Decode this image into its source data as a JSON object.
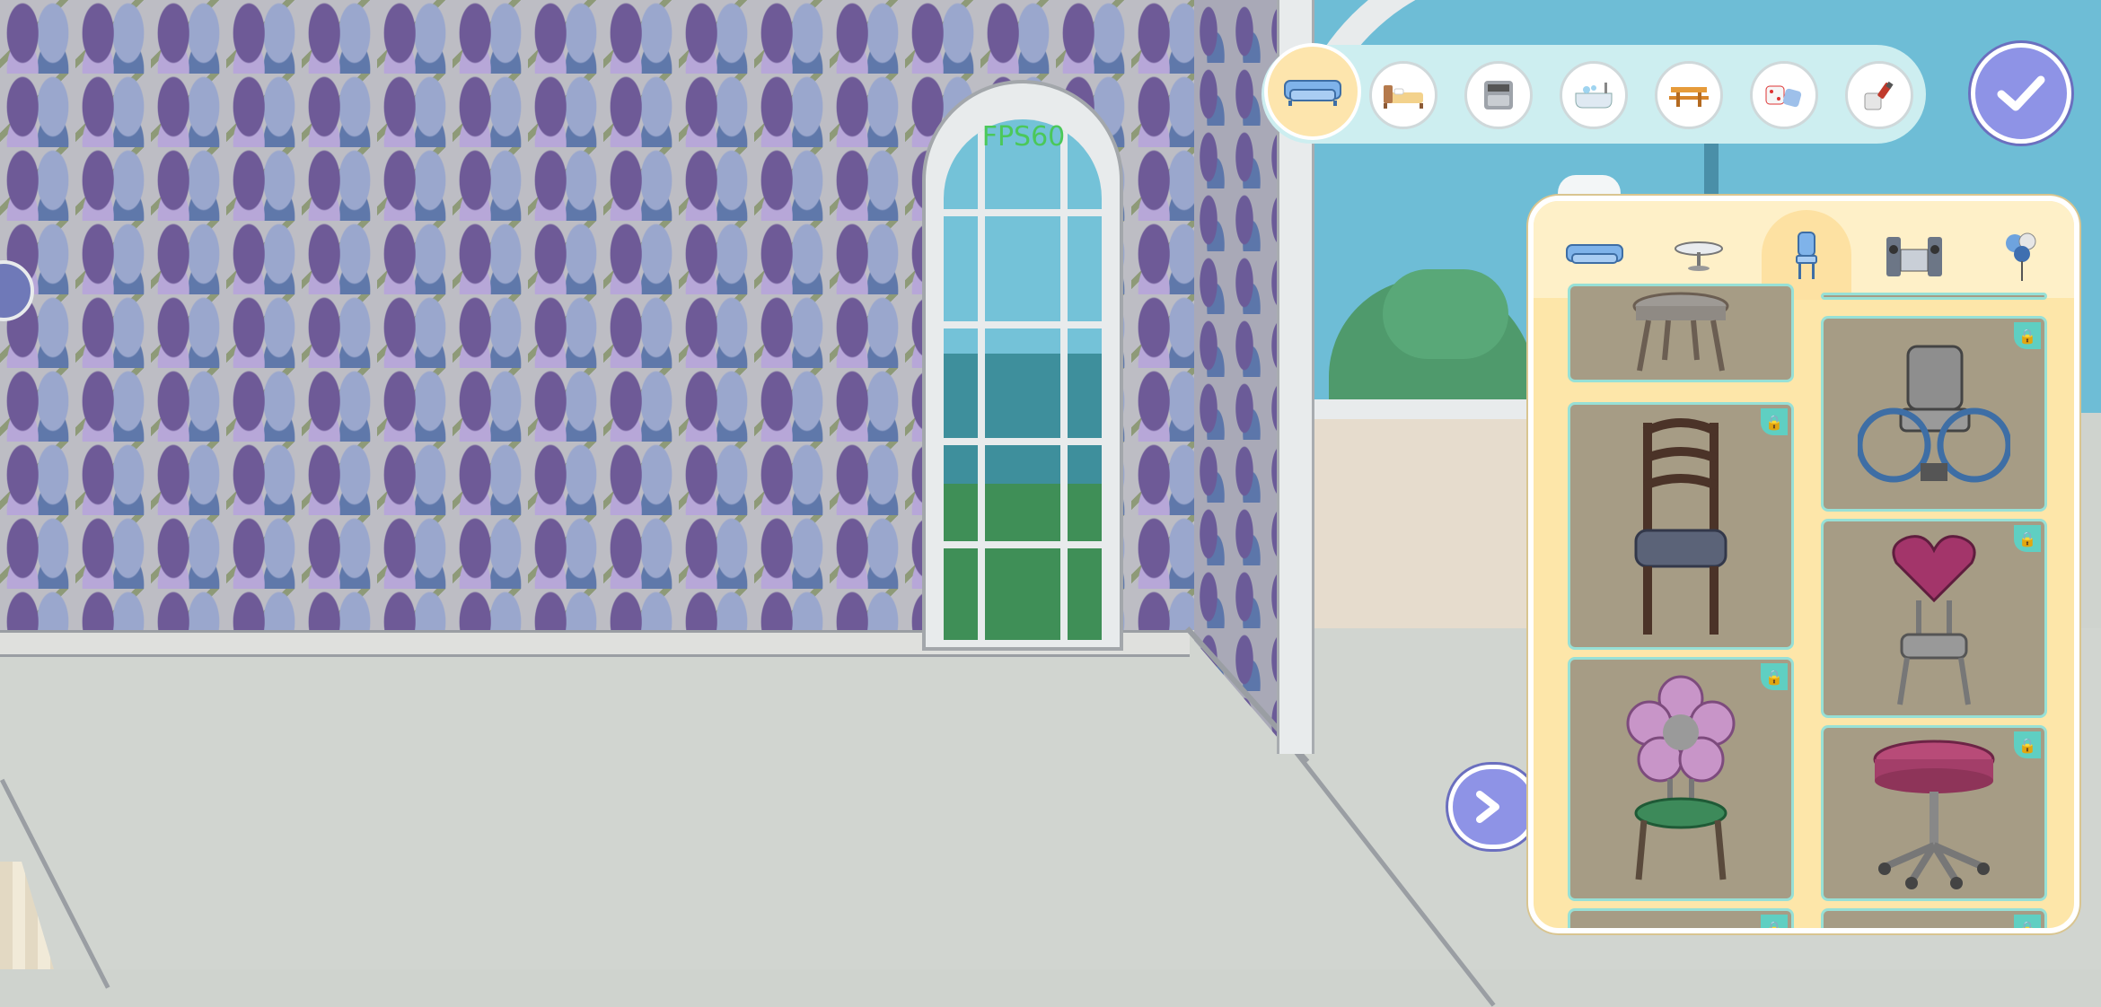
{
  "fps_overlay": "FPS60",
  "category_toolbar": {
    "items": [
      {
        "name": "living-room",
        "icon": "sofa-icon",
        "selected": true
      },
      {
        "name": "bedroom",
        "icon": "bed-icon"
      },
      {
        "name": "kitchen",
        "icon": "stove-icon"
      },
      {
        "name": "bathroom",
        "icon": "bathtub-icon"
      },
      {
        "name": "outdoor",
        "icon": "picnic-table-icon"
      },
      {
        "name": "toys",
        "icon": "dice-toys-icon"
      },
      {
        "name": "decor",
        "icon": "paint-bucket-icon"
      }
    ]
  },
  "panel": {
    "tabs": [
      {
        "name": "sofas",
        "icon": "sofa-icon"
      },
      {
        "name": "tables",
        "icon": "round-table-icon"
      },
      {
        "name": "chairs",
        "icon": "chair-icon",
        "selected": true
      },
      {
        "name": "electronics",
        "icon": "stereo-icon"
      },
      {
        "name": "decorations",
        "icon": "balloons-icon"
      }
    ],
    "items": [
      {
        "name": "round-stool",
        "locked": false
      },
      {
        "name": "wheelchair",
        "locked": true
      },
      {
        "name": "wooden-ladder-back-chair",
        "locked": true
      },
      {
        "name": "heart-back-chair",
        "locked": true
      },
      {
        "name": "flower-back-chair",
        "locked": true
      },
      {
        "name": "pink-office-stool",
        "locked": true
      }
    ]
  },
  "colors": {
    "accent_purple": "#8e93e6",
    "toolbar_bg": "#cdeef0",
    "panel_bg": "#fde6a9",
    "lock_badge": "#5fcfc2"
  }
}
